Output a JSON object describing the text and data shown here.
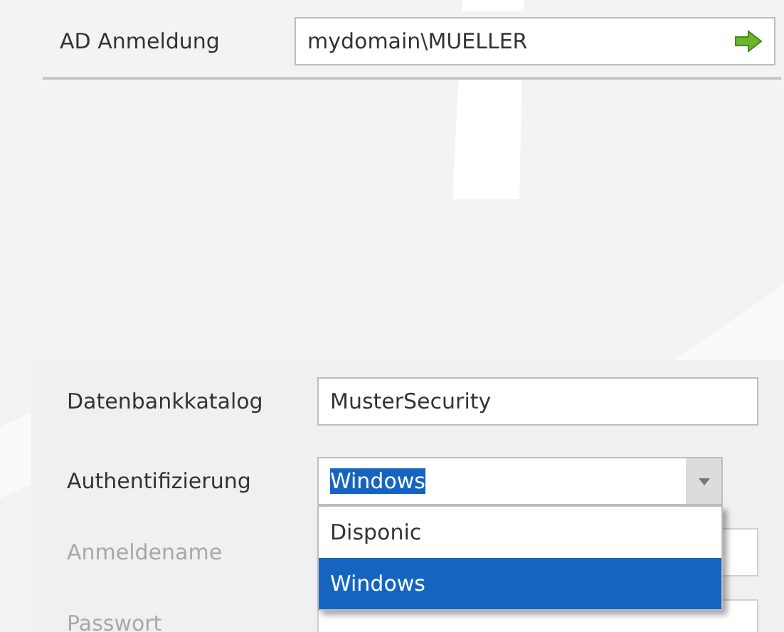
{
  "ad_login": {
    "label": "AD Anmeldung",
    "value": "mydomain\\MUELLER"
  },
  "form": [
    {
      "kind": "text",
      "label": "Datenbankkatalog",
      "value": "MusterSecurity",
      "disabled": false
    },
    {
      "kind": "combo",
      "label": "Authentifizierung",
      "value": "Windows",
      "disabled": false,
      "highlighted": true,
      "expanded": true,
      "options": [
        {
          "label": "Disponic",
          "selected": false
        },
        {
          "label": "Windows",
          "selected": true
        }
      ]
    },
    {
      "kind": "text",
      "label": "Anmeldename",
      "disabled": true
    },
    {
      "kind": "text",
      "label": "Passwort",
      "disabled": true
    }
  ]
}
